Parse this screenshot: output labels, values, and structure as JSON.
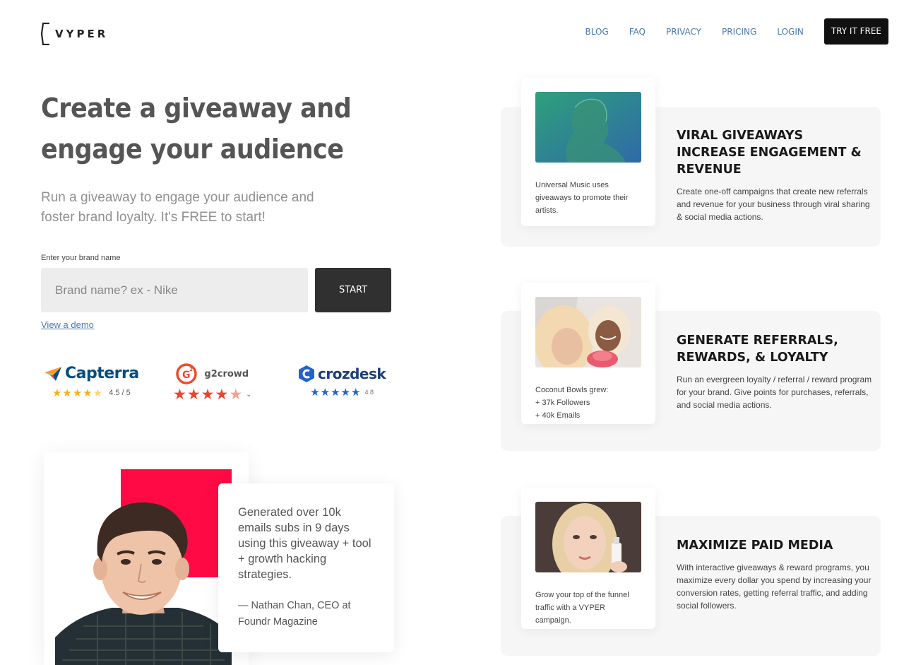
{
  "header": {
    "logo_text": "VYPER",
    "nav": [
      "BLOG",
      "FAQ",
      "PRIVACY",
      "PRICING",
      "LOGIN"
    ],
    "cta": "TRY IT FREE"
  },
  "hero": {
    "title_line1": "Create a giveaway and",
    "title_line2": "engage your audience",
    "subtitle_line1": "Run a giveaway to engage your audience and",
    "subtitle_line2": "foster brand loyalty. It's FREE to start!",
    "input_label": "Enter your brand name",
    "input_placeholder": "Brand name? ex - Nike",
    "start_button": "START",
    "demo_link": "View a demo"
  },
  "badges": [
    {
      "name": "Capterra",
      "rating": "4.5 / 5",
      "stars": 4.5,
      "star_color": "#f6b21b"
    },
    {
      "name": "g2crowd",
      "rating": "",
      "stars": 4.5,
      "star_color": "#e8452c"
    },
    {
      "name": "crozdesk",
      "rating": "4.8",
      "stars": 5,
      "star_color": "#2163c8"
    }
  ],
  "testimonial": {
    "quote": "Generated over 10k emails subs in 9 days using this giveaway + tool + growth hacking strategies.",
    "author_line1": "— Nathan Chan, CEO at",
    "author_line2": "Foundr Magazine",
    "accent_color": "#ff0a45"
  },
  "features": [
    {
      "caption": "Universal Music uses giveaways to promote their artists.",
      "title": "VIRAL GIVEAWAYS INCREASE ENGAGEMENT & REVENUE",
      "description": "Create one-off campaigns that create new referrals and revenue for your business through viral sharing & social media actions."
    },
    {
      "caption_line1": "Coconut Bowls grew:",
      "caption_line2": "+ 37k Followers",
      "caption_line3": "+ 40k Emails",
      "title": "GENERATE REFERRALS, REWARDS, & LOYALTY",
      "description": "Run an evergreen loyalty / referral / reward program for your brand. Give points for purchases, referrals, and social media actions."
    },
    {
      "caption": "Grow your top of the funnel traffic with a VYPER campaign.",
      "title": "MAXIMIZE PAID MEDIA",
      "description": "With interactive giveaways & reward programs, you maximize every dollar you spend by increasing your conversion rates, getting referral traffic, and adding social followers."
    }
  ]
}
